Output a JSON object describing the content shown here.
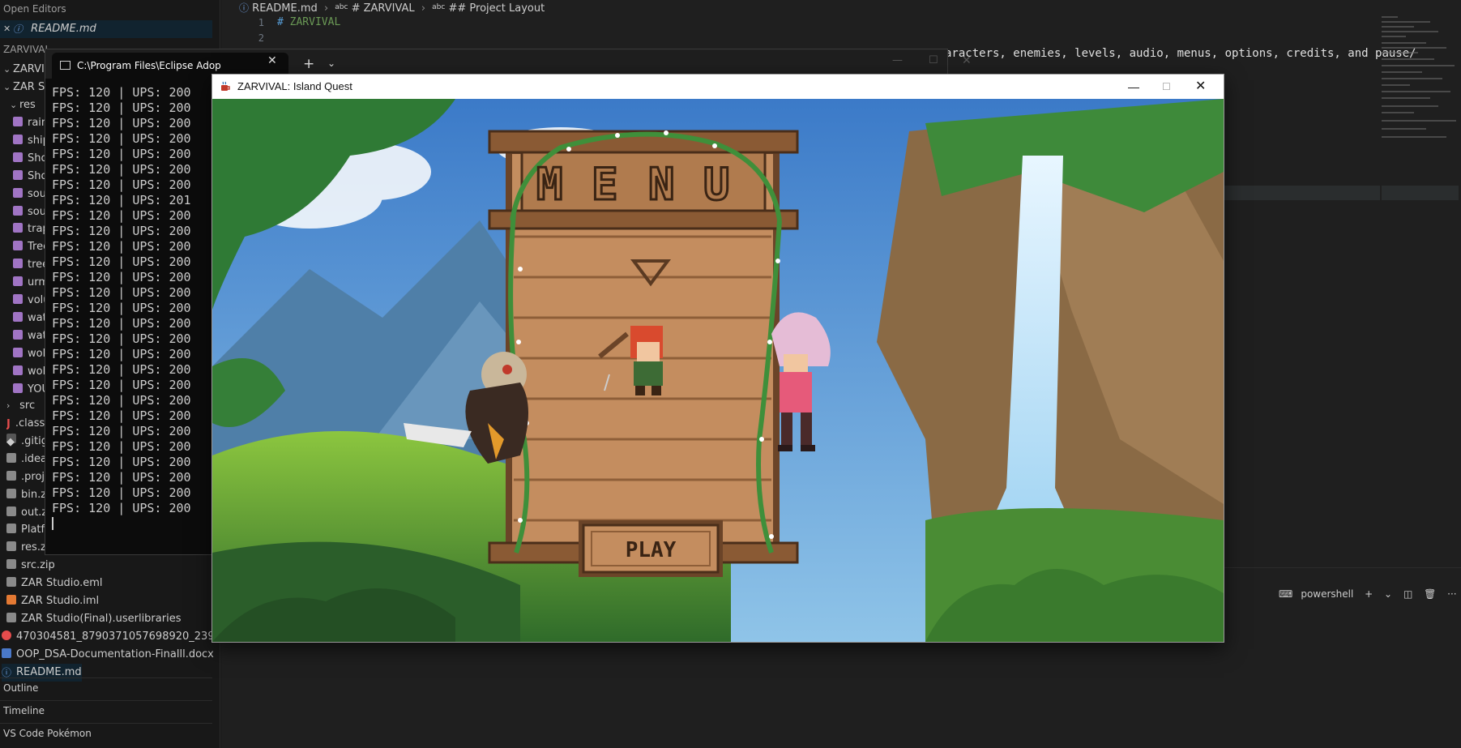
{
  "sidebar": {
    "open_editors_title": "Open Editors",
    "open_editor_file": "README.md",
    "folder1": "ZARVIVAL",
    "folder2": "ZARVIVAL",
    "project": "ZAR St",
    "res_folder": "res",
    "res_items": [
      "rain",
      "ship",
      "Sho",
      "Sho",
      "sou",
      "sou",
      "trap",
      "Tree",
      "tree",
      "urm",
      "volu",
      "wate",
      "wate",
      "wolf",
      "wolf",
      "YOU"
    ],
    "src_folder": "src",
    "files": [
      ".class",
      ".gitig",
      ".idea.",
      ".proje",
      "bin.zi",
      "out.zi",
      "Platf",
      "res.zi",
      "src.zip",
      "ZAR Studio.eml",
      "ZAR Studio.iml",
      "ZAR Studio(Final).userlibraries",
      "470304581_8790371057698920_2399837...",
      "OOP_DSA-Documentation-Finalll.docx",
      "README.md"
    ],
    "outline": "Outline",
    "timeline": "Timeline",
    "pokemon": "VS Code Pokémon"
  },
  "editor": {
    "breadcrumb": [
      "README.md",
      "# ZARVIVAL",
      "## Project Layout"
    ],
    "abc_label": "abc",
    "line_numbers": [
      "1",
      "2"
    ],
    "line1_hash": "#",
    "line1_text": "ZARVIVAL",
    "line3_text": "aracters, enemies, levels, audio, menus, options, credits, and pause/"
  },
  "terminal_bar": {
    "shell": "powershell",
    "plus": "+",
    "chevron": "⌄",
    "split": "◫",
    "trash": "🗑",
    "more": "···",
    "maximize": "⛶"
  },
  "console": {
    "tab_title": "C:\\Program Files\\Eclipse Adop",
    "close": "✕",
    "plus": "+",
    "chevron": "⌄",
    "minimize": "—",
    "maximize": "☐",
    "win_close": "✕",
    "lines": [
      "FPS: 120 | UPS: 200",
      "FPS: 120 | UPS: 200",
      "FPS: 120 | UPS: 200",
      "FPS: 120 | UPS: 200",
      "FPS: 120 | UPS: 200",
      "FPS: 120 | UPS: 200",
      "FPS: 120 | UPS: 200",
      "FPS: 120 | UPS: 201",
      "FPS: 120 | UPS: 200",
      "FPS: 120 | UPS: 200",
      "FPS: 120 | UPS: 200",
      "FPS: 120 | UPS: 200",
      "FPS: 120 | UPS: 200",
      "FPS: 120 | UPS: 200",
      "FPS: 120 | UPS: 200",
      "FPS: 120 | UPS: 200",
      "FPS: 120 | UPS: 200",
      "FPS: 120 | UPS: 200",
      "FPS: 120 | UPS: 200",
      "FPS: 120 | UPS: 200",
      "FPS: 120 | UPS: 200",
      "FPS: 120 | UPS: 200",
      "FPS: 120 | UPS: 200",
      "FPS: 120 | UPS: 200",
      "FPS: 120 | UPS: 200",
      "FPS: 120 | UPS: 200",
      "FPS: 120 | UPS: 200",
      "FPS: 120 | UPS: 200"
    ]
  },
  "game": {
    "title": "ZARVIVAL: Island Quest",
    "minimize": "—",
    "maximize": "☐",
    "close": "✕",
    "menu_letters": [
      "M",
      "E",
      "N",
      "U"
    ],
    "play_label": "PLAY"
  },
  "colors": {
    "accent_green": "#6a9955",
    "keyword_blue": "#569cd6",
    "wood": "#c48d5f",
    "wood_dark": "#5a3a22",
    "vine": "#3f8f3a"
  }
}
